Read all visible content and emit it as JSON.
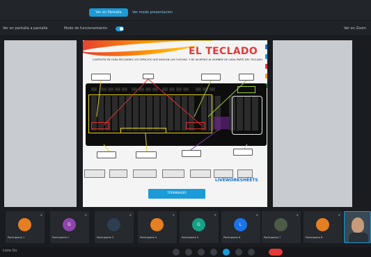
{
  "topbar": {
    "button_label": "Ver en Pantalla",
    "link_label": "Ver modo presentación"
  },
  "toolbar": {
    "left_label": "Ver en pantalla a pantalla",
    "mode_label": "Modo de funcionamiento",
    "right_label": "Ver en Zoom"
  },
  "slide": {
    "title": "EL TECLADO",
    "instructions": "COMPLETA EN CADA RECUADRO LOS ESPACIOS QUE INDICAN LAS FLECHAS, Y DE ACUERDO AL NOMBRE DE CADA PARTE DEL TECLADO.",
    "chips": [
      "",
      "",
      "",
      "",
      "",
      "",
      ""
    ],
    "brand": "LIVEWORKSHEETS",
    "send_button": "TERMINADO"
  },
  "side_icon_colors": [
    "#1a6fd0",
    "#1a9bd7",
    "#e53935",
    "#ff9800",
    "#43a047"
  ],
  "participants": [
    {
      "name": "Participante 1",
      "initial": "",
      "color": "#e67e22"
    },
    {
      "name": "Participante 2",
      "initial": "G",
      "color": "#8e44ad"
    },
    {
      "name": "Participante 3",
      "initial": "",
      "color": "#2c3e50"
    },
    {
      "name": "Participante 4",
      "initial": "",
      "color": "#e67e22"
    },
    {
      "name": "Participante 5",
      "initial": "G",
      "color": "#16a085"
    },
    {
      "name": "Participante 6",
      "initial": "L",
      "color": "#1a73e8"
    },
    {
      "name": "Participante 7",
      "initial": "",
      "color": "#4e5a48"
    },
    {
      "name": "Participante 8",
      "initial": "",
      "color": "#e67e22"
    }
  ],
  "bottom": {
    "meeting_name": "Lista Qu"
  }
}
